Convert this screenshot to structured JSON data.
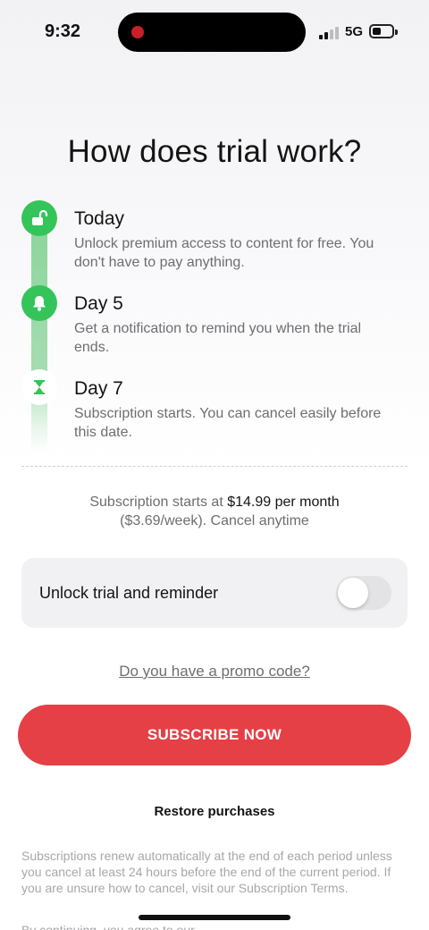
{
  "status_bar": {
    "time": "9:32",
    "network": "5G",
    "icons": [
      "recording-indicator-icon",
      "signal-icon",
      "battery-icon"
    ]
  },
  "title": "How does trial work?",
  "timeline": {
    "steps": [
      {
        "title": "Today",
        "description": "Unlock premium access to content for free. You don't have to pay anything.",
        "icon": "unlock-icon"
      },
      {
        "title": "Day 5",
        "description": "Get a notification to remind you when the trial ends.",
        "icon": "bell-icon"
      },
      {
        "title": "Day 7",
        "description": "Subscription starts. You can cancel easily before this date.",
        "icon": "hourglass-icon"
      }
    ]
  },
  "pricing": {
    "line1_prefix": "Subscription starts at ",
    "price": "$14.99 per month",
    "line2": "($3.69/week). Cancel anytime"
  },
  "toggle": {
    "label": "Unlock trial and reminder",
    "enabled": false
  },
  "promo": {
    "label": "Do you have a promo code?"
  },
  "subscribe": {
    "label": "SUBSCRIBE NOW"
  },
  "restore": {
    "label": "Restore purchases"
  },
  "legal": {
    "text": "Subscriptions renew automatically at the end of each period unless you cancel at least 24 hours before the end of the current period. If you are unsure how to cancel, visit our Subscription Terms.",
    "cut_text": "By continuing, you agree to our"
  },
  "colors": {
    "accent_green": "#35c45a",
    "subscribe_red": "#e54046",
    "muted_text": "#6e6e73"
  }
}
